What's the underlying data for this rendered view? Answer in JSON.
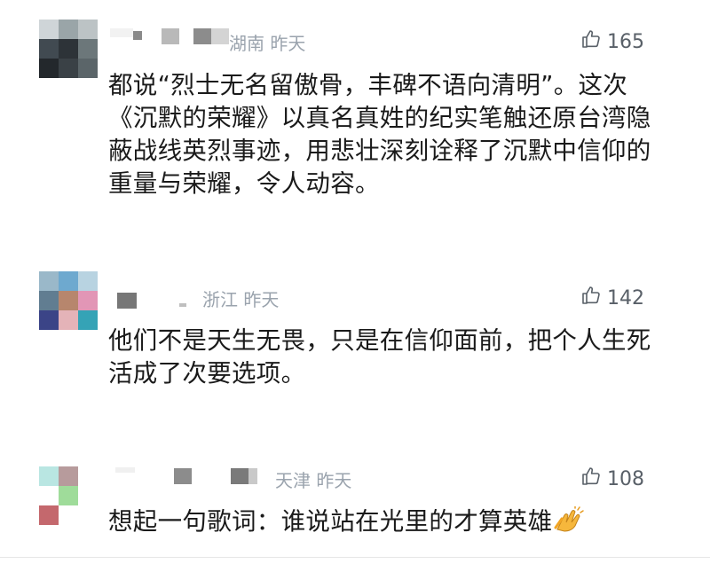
{
  "comments": [
    {
      "location": "湖南",
      "time": "昨天",
      "likes": "165",
      "text": "都说“烈士无名留傲骨，丰碑不语向清明”。这次《沉默的荣耀》以真名真姓的纪实笔触还原台湾隐蔽战线英烈事迹，用悲壮深刻诠释了沉默中信仰的重量与荣耀，令人动容。",
      "avatar_colors": [
        "#cfd5d8",
        "#9aa5a8",
        "#bcc3c5",
        "#414a51",
        "#2d3338",
        "#6c777a",
        "#23282c",
        "#3a4146",
        "#5b6569"
      ]
    },
    {
      "location": "浙江",
      "time": "昨天",
      "likes": "142",
      "text": "他们不是天生无畏，只是在信仰面前，把个人生死活成了次要选项。",
      "avatar_colors": [
        "#9ab8c9",
        "#6ea9cf",
        "#b8d3e1",
        "#617d91",
        "#b7866d",
        "#e296b6",
        "#3b4487",
        "#e4b3b8",
        "#35a3b6"
      ]
    },
    {
      "location": "天津",
      "time": "昨天",
      "likes": "108",
      "text": "想起一句歌词：谁说站在光里的才算英雄",
      "emoji": "clapping-hands-emoji",
      "avatar_colors": [
        "#b9e6e2",
        "#b79b9c",
        "#ffffff",
        "#9fdc9a",
        "#c4686d",
        "#ffffff"
      ]
    }
  ],
  "colors": {
    "meta": "#9aa3ad",
    "text": "#1a1a1a",
    "likes": "#596068"
  }
}
